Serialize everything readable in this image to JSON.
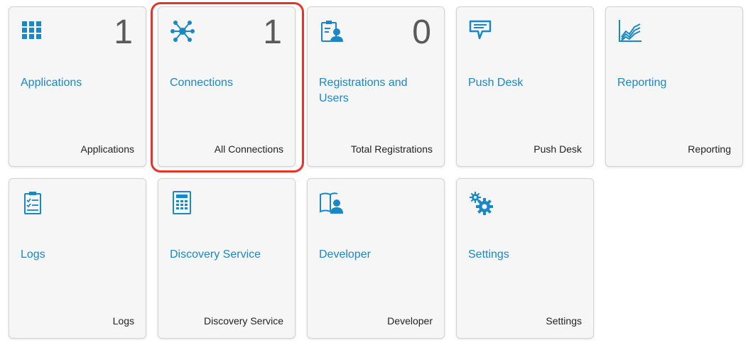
{
  "tiles": [
    {
      "title": "Applications",
      "count": "1",
      "footer": "Applications",
      "icon": "grid-icon"
    },
    {
      "title": "Connections",
      "count": "1",
      "footer": "All Connections",
      "icon": "network-icon"
    },
    {
      "title": "Registrations and Users",
      "count": "0",
      "footer": "Total Registrations",
      "icon": "user-clipboard-icon"
    },
    {
      "title": "Push Desk",
      "count": "",
      "footer": "Push Desk",
      "icon": "speech-bubble-icon"
    },
    {
      "title": "Reporting",
      "count": "",
      "footer": "Reporting",
      "icon": "line-chart-icon"
    },
    {
      "title": "Logs",
      "count": "",
      "footer": "Logs",
      "icon": "checklist-icon"
    },
    {
      "title": "Discovery Service",
      "count": "",
      "footer": "Discovery Service",
      "icon": "calculator-icon"
    },
    {
      "title": "Developer",
      "count": "",
      "footer": "Developer",
      "icon": "book-user-icon"
    },
    {
      "title": "Settings",
      "count": "",
      "footer": "Settings",
      "icon": "gears-icon"
    }
  ],
  "colors": {
    "accent": "#1a87c6",
    "highlight": "#e8322a",
    "count": "#5a5a5a"
  }
}
